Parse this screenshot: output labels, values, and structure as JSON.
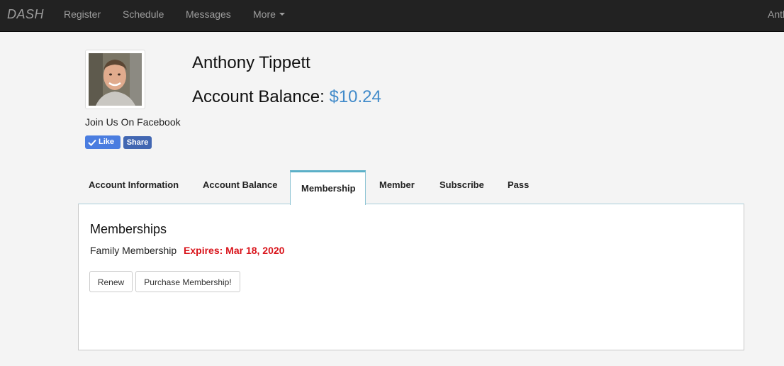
{
  "navbar": {
    "brand": "DASH",
    "links": [
      "Register",
      "Schedule",
      "Messages",
      "More"
    ],
    "user_partial": "Anth"
  },
  "profile": {
    "name": "Anthony Tippett",
    "balance_label": "Account Balance:",
    "balance_value": "$10.24",
    "facebook_label": "Join Us On Facebook",
    "like_label": "Like",
    "share_label": "Share"
  },
  "tabs": [
    {
      "label": "Account Information",
      "active": false
    },
    {
      "label": "Account Balance",
      "active": false
    },
    {
      "label": "Membership",
      "active": true
    },
    {
      "label": "Member",
      "active": false
    },
    {
      "label": "Subscribe",
      "active": false
    },
    {
      "label": "Pass",
      "active": false
    }
  ],
  "membership_panel": {
    "title": "Memberships",
    "membership_name": "Family Membership",
    "expires_text": "Expires: Mar 18, 2020",
    "buttons": {
      "renew": "Renew",
      "purchase": "Purchase Membership!"
    }
  },
  "colors": {
    "navbar_bg": "#222222",
    "accent_blue": "#428bca",
    "expires_red": "#d9141b",
    "facebook_blue": "#4267b2",
    "tab_accent": "#5bb0c8"
  },
  "icons": {
    "like": "check-icon",
    "more": "caret-down-icon"
  }
}
